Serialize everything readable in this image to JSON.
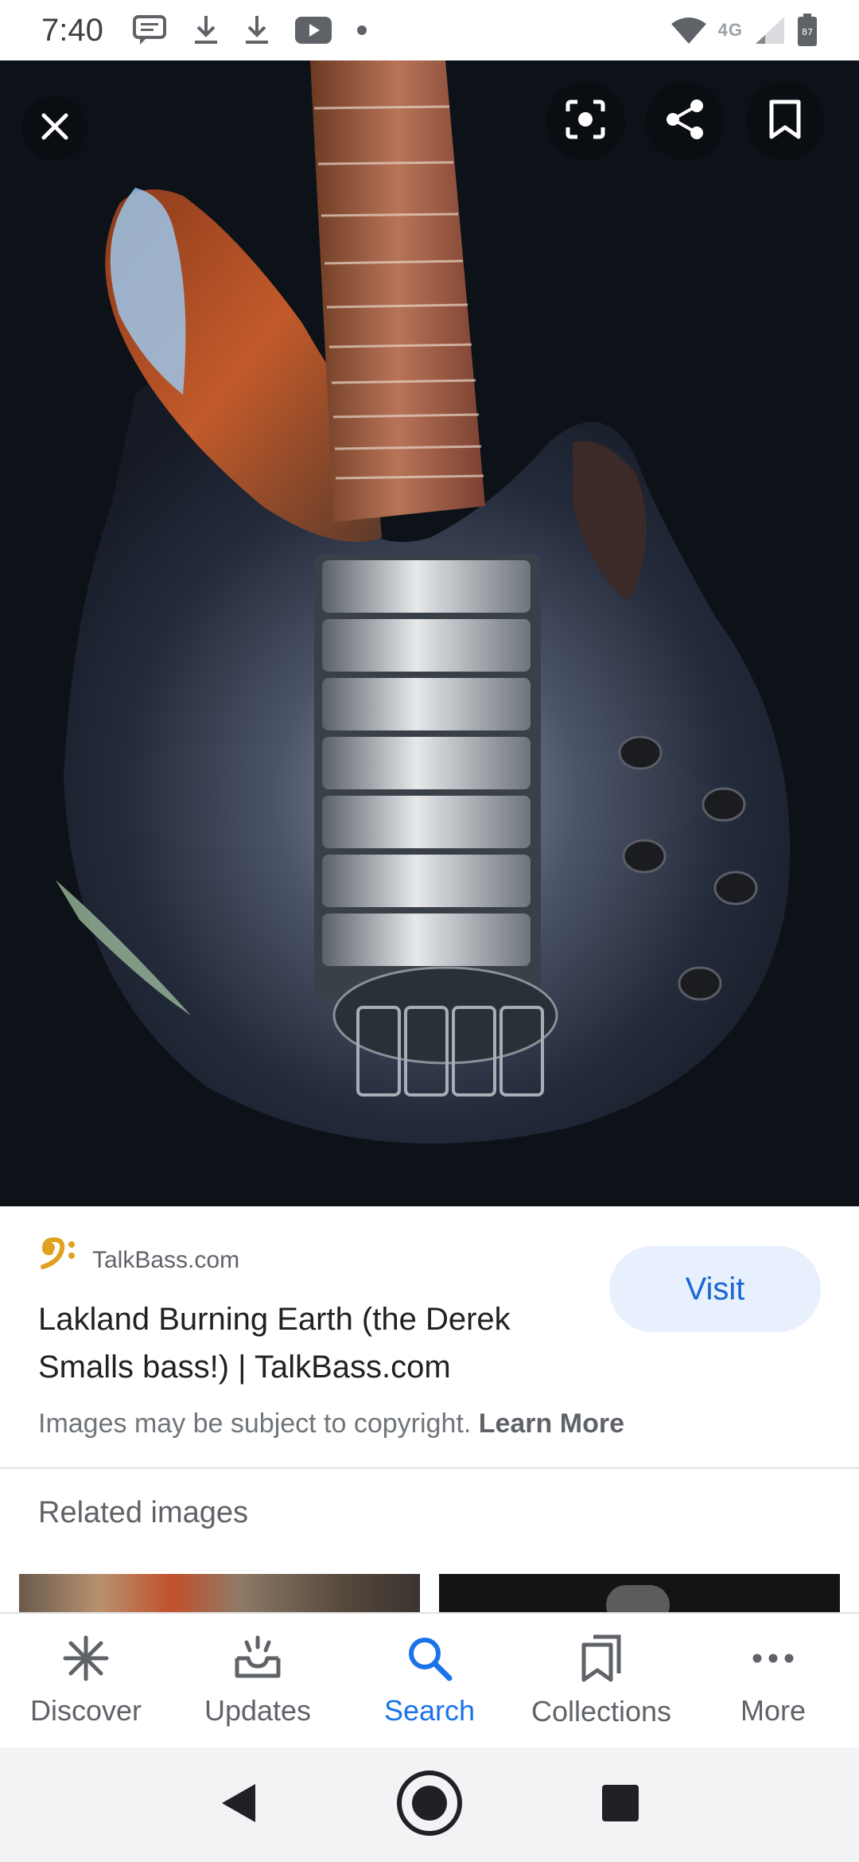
{
  "status_bar": {
    "time": "7:40",
    "network_label": "4G",
    "battery_level": "87",
    "icons_left": [
      "message-icon",
      "download-icon",
      "download-icon",
      "youtube-icon",
      "dot-icon"
    ],
    "icons_right": [
      "wifi-icon",
      "signal-icon",
      "battery-icon"
    ]
  },
  "viewer": {
    "buttons": [
      "close-icon",
      "lens-icon",
      "share-icon",
      "bookmark-icon"
    ],
    "colors": {
      "background": "#0d1218",
      "button": "#0a0d12"
    }
  },
  "result": {
    "source": "TalkBass.com",
    "source_icon": "bass-clef-icon",
    "title": "Lakland Burning Earth (the Derek Smalls bass!) | TalkBass.com",
    "visit_label": "Visit",
    "copyright_text": "Images may be subject to copyright.",
    "learn_more_label": "Learn More"
  },
  "related": {
    "title": "Related images"
  },
  "bottom_nav": {
    "active": "Search",
    "items": [
      {
        "label": "Discover",
        "icon": "asterisk-icon"
      },
      {
        "label": "Updates",
        "icon": "inbox-tray-icon"
      },
      {
        "label": "Search",
        "icon": "search-icon"
      },
      {
        "label": "Collections",
        "icon": "collections-icon"
      },
      {
        "label": "More",
        "icon": "more-horizontal-icon"
      }
    ]
  },
  "system_nav": [
    "back-icon",
    "home-icon",
    "recents-icon"
  ],
  "colors": {
    "accent": "#1a73e8",
    "visit_bg": "#e8f0fe",
    "visit_text": "#1967d2"
  }
}
